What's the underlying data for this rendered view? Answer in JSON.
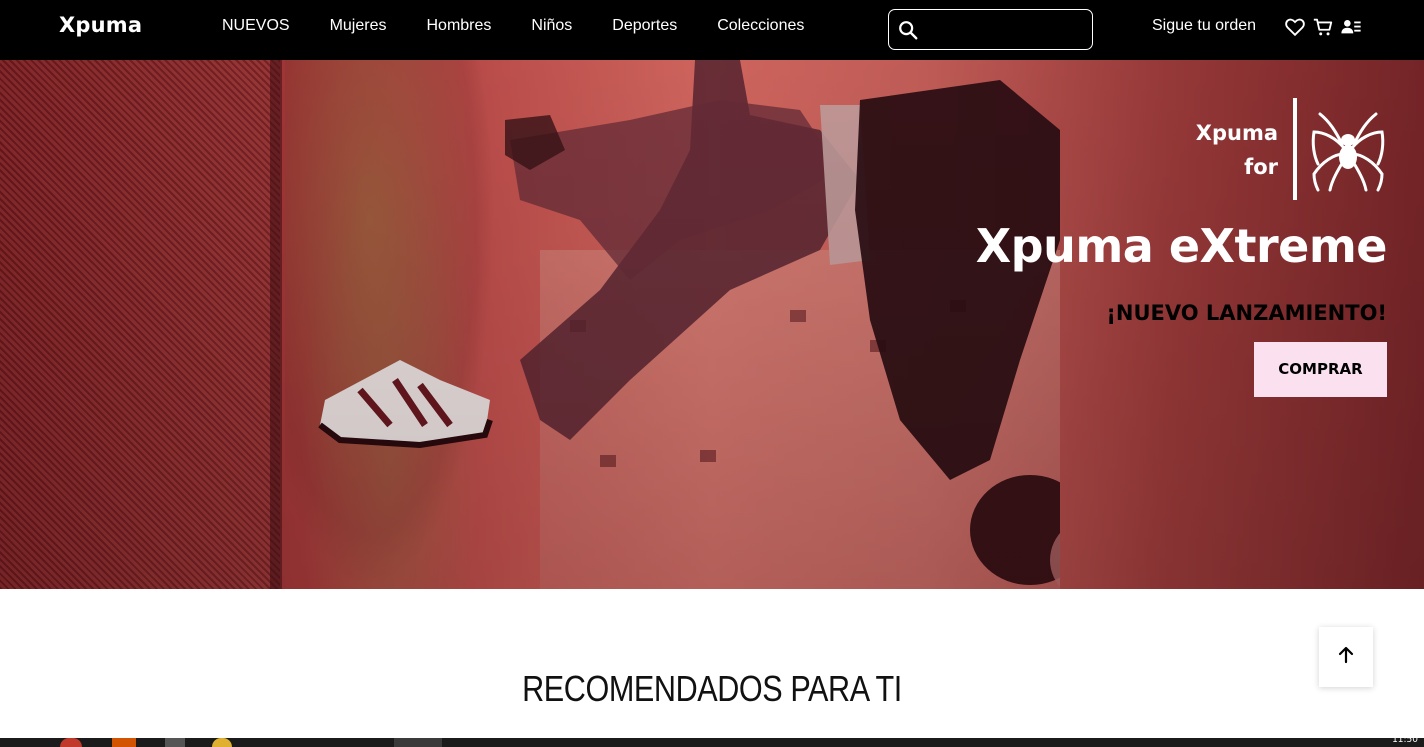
{
  "nav": {
    "brand": "Xpuma",
    "links": [
      "NUEVOS",
      "Mujeres",
      "Hombres",
      "Niños",
      "Deportes",
      "Colecciones"
    ],
    "search_placeholder": "",
    "track_order": "Sigue tu orden",
    "icons": [
      "search-icon",
      "heart-icon",
      "cart-icon",
      "user-icon"
    ]
  },
  "hero": {
    "logo_line1": "Xpuma",
    "logo_line2": "for",
    "title": "Xpuma eXtreme",
    "subtitle": "¡NUEVO LANZAMIENTO!",
    "cta": "COMPRAR",
    "button_color": "#fbe0ef",
    "overlay_color": "#c5524f"
  },
  "content": {
    "section_title": "RECOMENDADOS PARA TI"
  },
  "taskbar": {
    "clock": "11:50"
  }
}
